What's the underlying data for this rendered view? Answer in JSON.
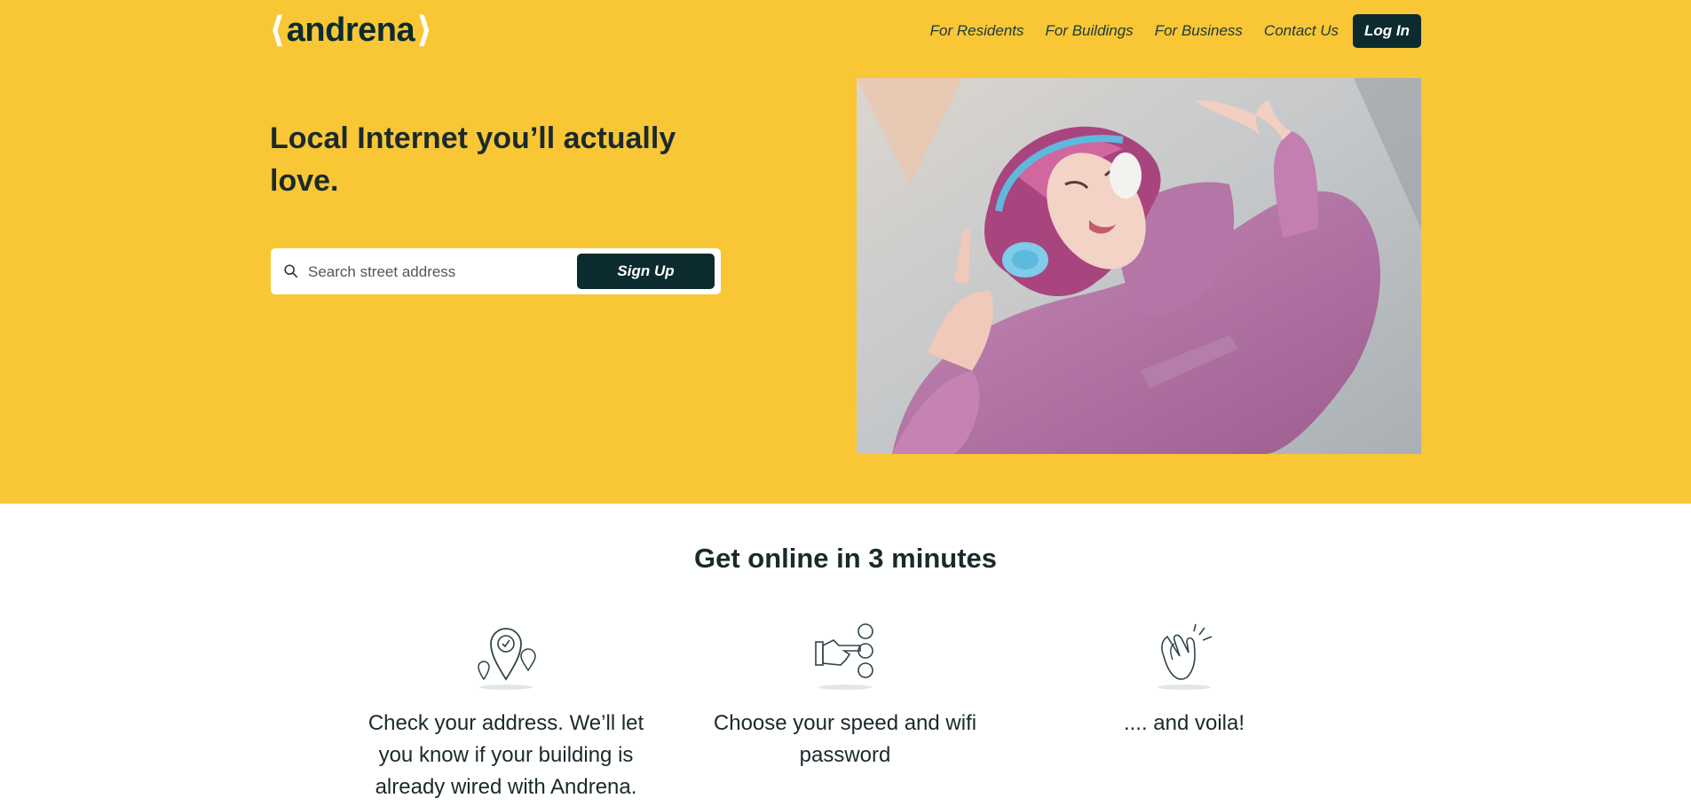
{
  "brand": {
    "logo_text": "andrena",
    "bracket_color": "#ffffff",
    "accent": "#f9c635",
    "dark": "#0b2b2e"
  },
  "nav": {
    "items": [
      {
        "label": "For Residents"
      },
      {
        "label": "For Buildings"
      },
      {
        "label": "For Business"
      },
      {
        "label": "Contact Us"
      }
    ],
    "login_label": "Log In"
  },
  "hero": {
    "headline": "Local Internet you’ll actually love.",
    "search": {
      "placeholder": "Search street address",
      "value": "",
      "icon": "search-icon"
    },
    "signup_label": "Sign Up",
    "image": "illustrated woman with pink hair and blue headphones in pink hoodie lying down"
  },
  "how_it_works": {
    "title": "Get online in 3 minutes",
    "steps": [
      {
        "icon": "location-pin-check-icon",
        "text": "Check your address. We’ll let you know if your building is already wired with Andrena."
      },
      {
        "icon": "hand-pointing-buttons-icon",
        "text": "Choose your speed and wifi password"
      },
      {
        "icon": "clapping-hands-icon",
        "text": ".... and voila!"
      }
    ]
  }
}
